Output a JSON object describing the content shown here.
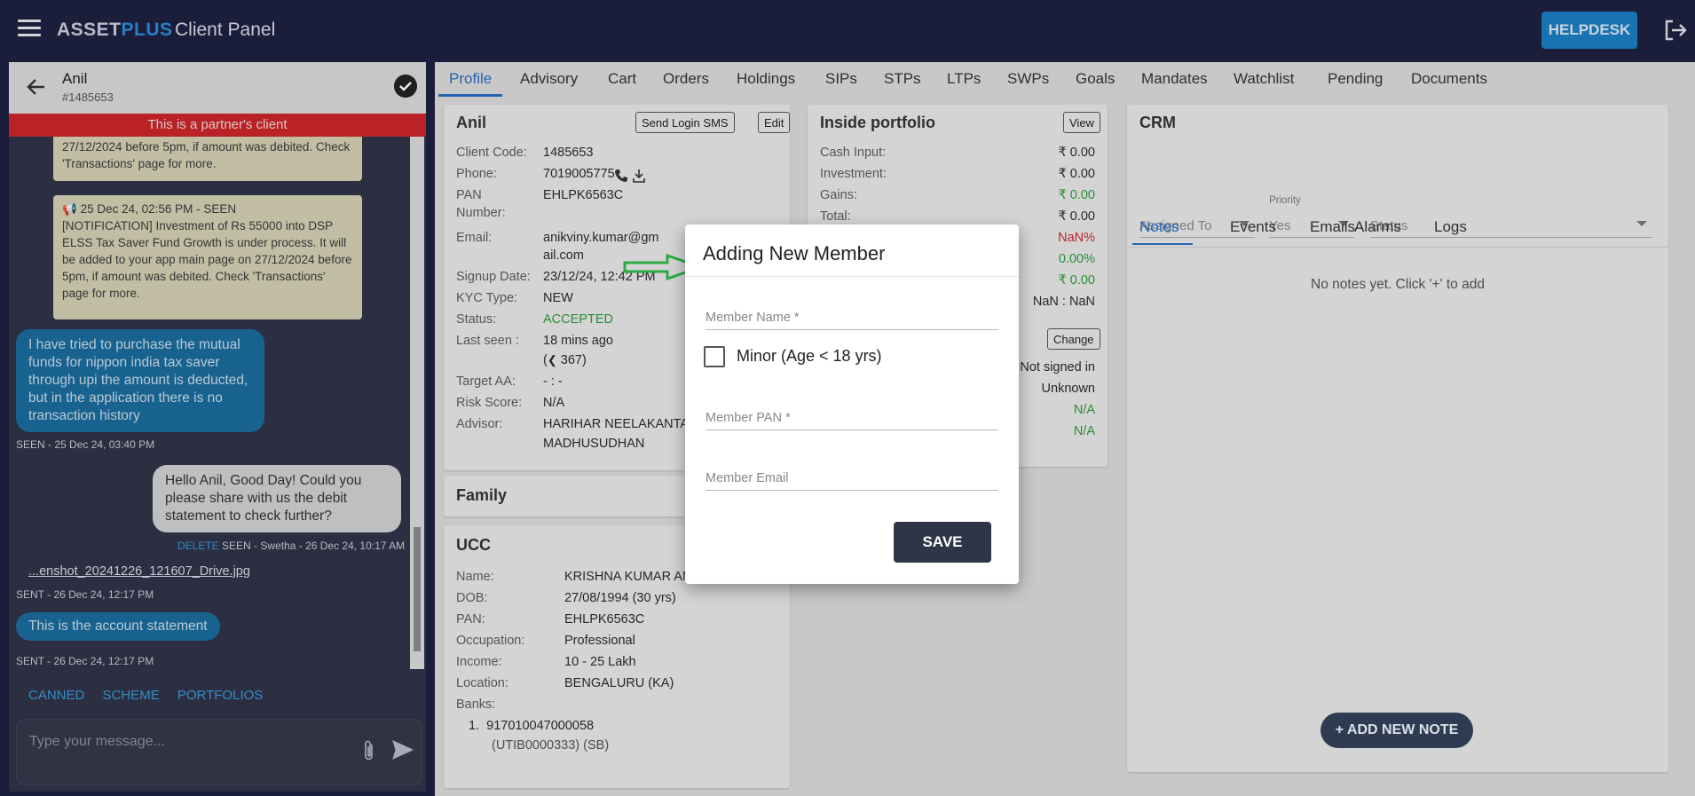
{
  "brand": {
    "asset": "ASSET",
    "plus": "PLUS",
    "panel": "Client Panel"
  },
  "helpdesk": "HELPDESK",
  "chat": {
    "name": "Anil",
    "id": "#1485653",
    "banner": "This is a partner's client",
    "notif1": "27/12/2024 before 5pm, if amount was debited. Check 'Transactions' page for more.",
    "notif2_head": "25 Dec 24, 02:56 PM - SEEN",
    "notif2_body": "[NOTIFICATION] Investment of Rs 55000 into DSP ELSS Tax Saver Fund Growth is under process. It will be added to your app main page on 27/12/2024 before 5pm, if amount was debited. Check 'Transactions' page for more.",
    "msg1": "I have tried to purchase the mutual funds for nippon india tax saver through upi the amount is deducted, but in the application there is no transaction history",
    "msg1_meta": "SEEN - 25 Dec 24, 03:40 PM",
    "msg2": "Hello Anil, Good Day! Could you please share with us the debit statement to check further?",
    "msg2_delete": "DELETE",
    "msg2_meta": "SEEN - Swetha - 26 Dec 24, 10:17 AM",
    "file": "...enshot_20241226_121607_Drive.jpg",
    "file_meta": "SENT - 26 Dec 24, 12:17 PM",
    "msg3": "This is the account statement",
    "msg3_meta": "SENT - 26 Dec 24, 12:17 PM",
    "quick": [
      "CANNED",
      "SCHEME",
      "PORTFOLIOS"
    ],
    "placeholder": "Type your message..."
  },
  "tabs": [
    "Profile",
    "Advisory",
    "Cart",
    "Orders",
    "Holdings",
    "SIPs",
    "STPs",
    "LTPs",
    "SWPs",
    "Goals",
    "Mandates",
    "Watchlist",
    "Pending",
    "Documents"
  ],
  "profile": {
    "name": "Anil",
    "send_sms": "Send Login SMS",
    "edit": "Edit",
    "client_code_label": "Client Code:",
    "client_code": "1485653",
    "phone_label": "Phone:",
    "phone": "7019005775",
    "pan_label": "PAN",
    "pan_label2": "Number:",
    "pan": "EHLPK6563C",
    "email_label": "Email:",
    "email1": "anikviny.kumar@gm",
    "email2": "ail.com",
    "signup_label": "Signup Date:",
    "signup": "23/12/24, 12:42 PM",
    "kyc_label": "KYC Type:",
    "kyc": "NEW",
    "status_label": "Status:",
    "status": "ACCEPTED",
    "lastseen_label": "Last seen :",
    "lastseen": "18 mins ago",
    "lastseen2": "367)",
    "target_label": "Target AA:",
    "target": "- : -",
    "risk_label": "Risk Score:",
    "risk": "N/A",
    "advisor_label": "Advisor:",
    "advisor1": "HARIHAR NEELAKANTA",
    "advisor2": "MADHUSUDHAN"
  },
  "family": {
    "title": "Family"
  },
  "ucc": {
    "title": "UCC",
    "name_label": "Name:",
    "name": "KRISHNA KUMAR AN",
    "dob_label": "DOB:",
    "dob": "27/08/1994 (30 yrs)",
    "pan_label": "PAN:",
    "pan": "EHLPK6563C",
    "occ_label": "Occupation:",
    "occ": "Professional",
    "income_label": "Income:",
    "income": "10 - 25 Lakh",
    "loc_label": "Location:",
    "loc": "BENGALURU (KA)",
    "banks_label": "Banks:",
    "bank1": "917010047000058",
    "bank1_ifsc": "(UTIB0000333) (SB)"
  },
  "portfolio": {
    "title": "Inside portfolio",
    "view": "View",
    "cash_label": "Cash Input:",
    "cash": "₹ 0.00",
    "inv_label": "Investment:",
    "inv": "₹ 0.00",
    "gains_label": "Gains:",
    "gains": "₹ 0.00",
    "total_label": "Total:",
    "total": "₹ 0.00",
    "nan_pct": "NaN%",
    "pct": "0.00%",
    "rupee": "₹ 0.00",
    "nan_nan": "NaN : NaN",
    "change": "Change",
    "not_signed": "Not signed in",
    "unknown": "Unknown",
    "na1": "N/A",
    "na2": "N/A"
  },
  "crm": {
    "title": "CRM",
    "assigned": "Assigned To",
    "priority_label": "Priority",
    "priority": "Yes",
    "status": "Status",
    "tabs": [
      "Notes",
      "Events",
      "Emails",
      "Alarms",
      "Logs"
    ],
    "empty": "No notes yet. Click '+' to add",
    "add_note": "+ ADD NEW NOTE"
  },
  "modal": {
    "title": "Adding New Member",
    "member_name": "Member Name *",
    "minor": "Minor (Age < 18 yrs)",
    "member_pan": "Member PAN *",
    "member_email": "Member Email",
    "save": "SAVE"
  }
}
